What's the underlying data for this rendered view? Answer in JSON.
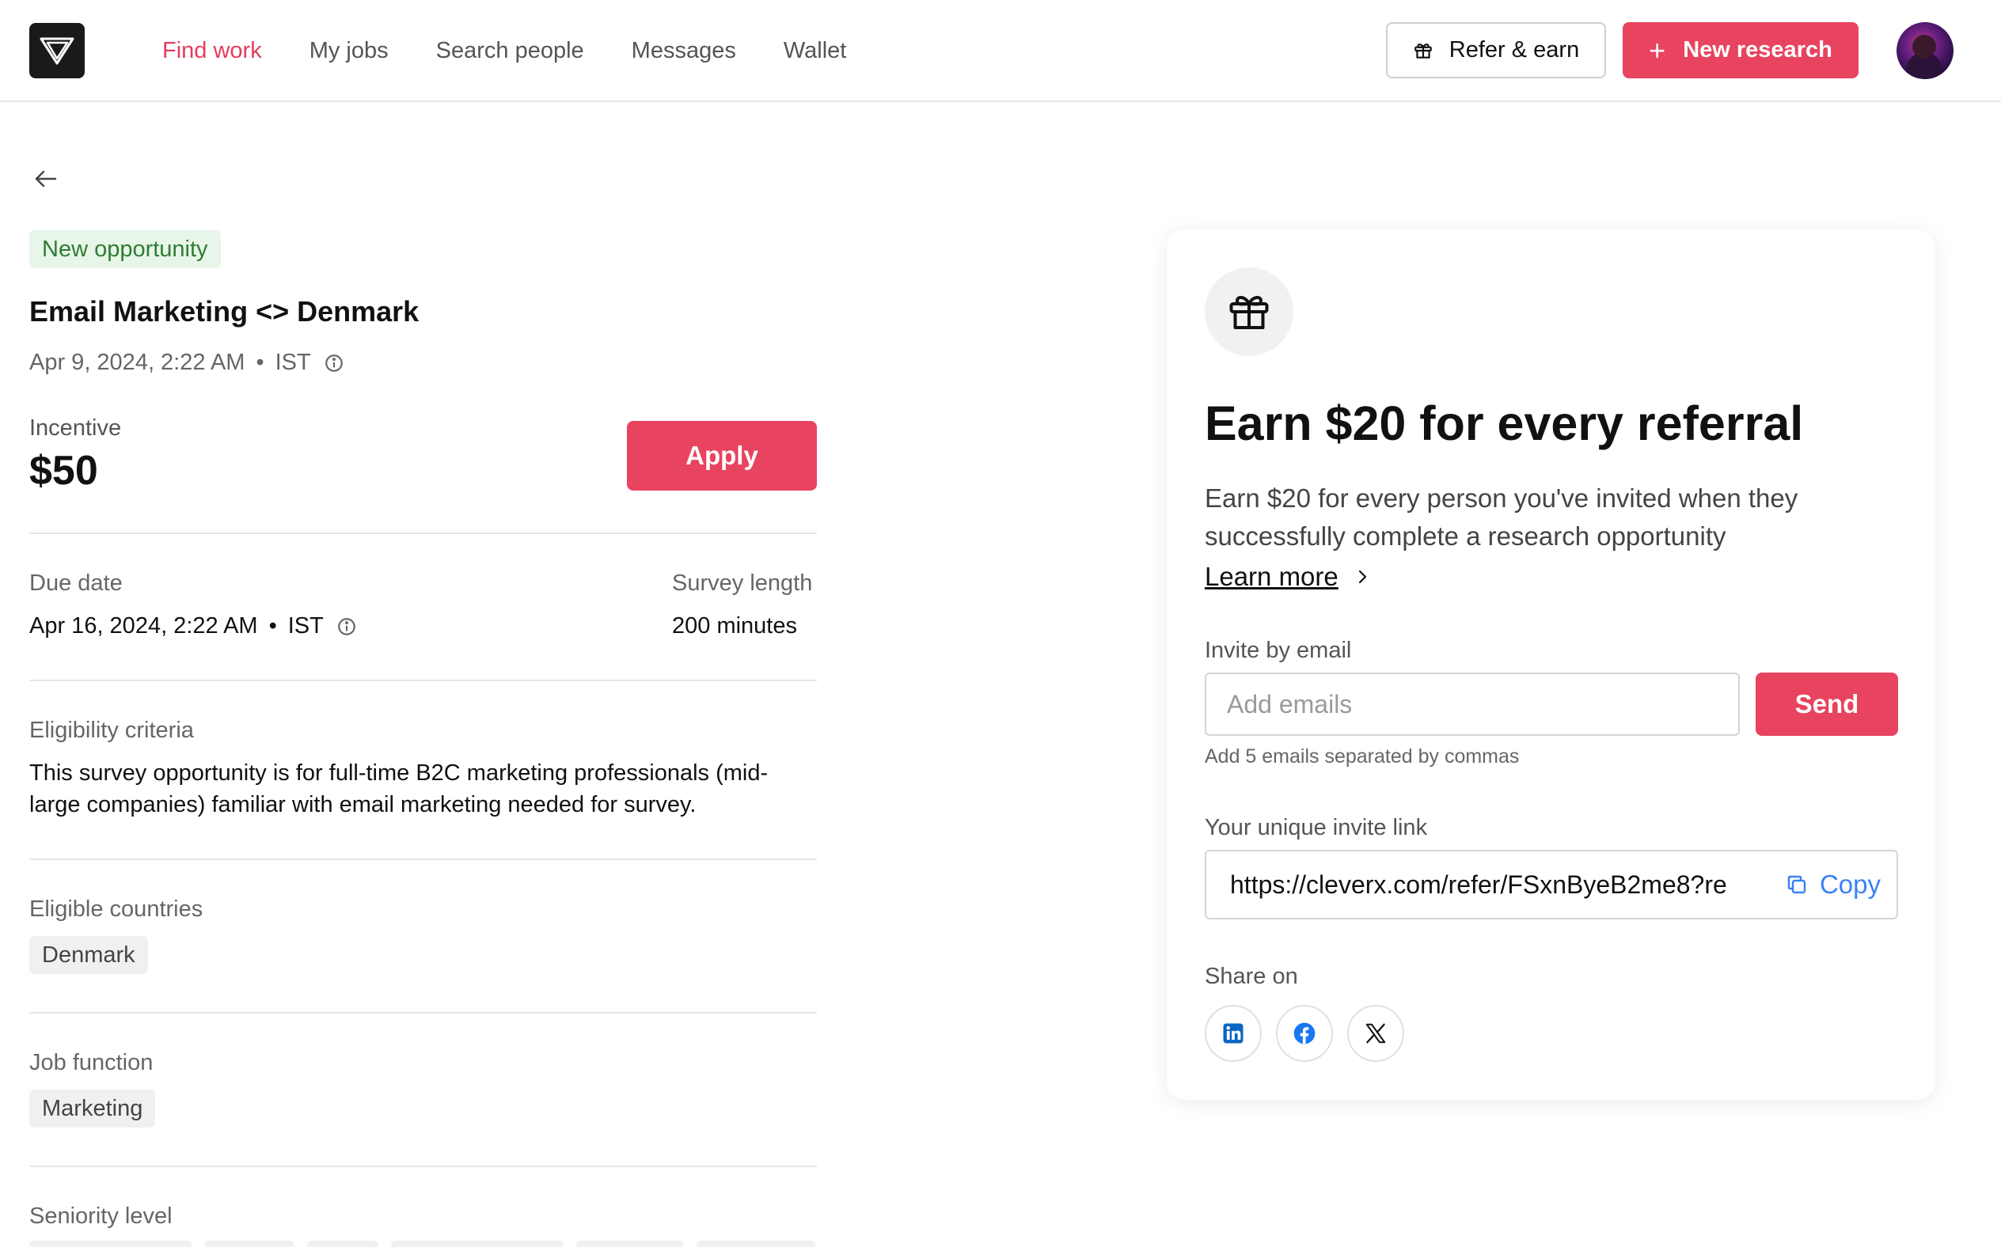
{
  "header": {
    "nav": [
      "Find work",
      "My jobs",
      "Search people",
      "Messages",
      "Wallet"
    ],
    "active_nav": "Find work",
    "refer_label": "Refer & earn",
    "new_research_label": "New research"
  },
  "job": {
    "badge": "New opportunity",
    "title": "Email Marketing <> Denmark",
    "posted_date": "Apr 9, 2024, 2:22 AM",
    "posted_tz": "IST",
    "incentive_label": "Incentive",
    "incentive_value": "$50",
    "apply_label": "Apply",
    "due_label": "Due date",
    "due_date": "Apr 16, 2024, 2:22 AM",
    "due_tz": "IST",
    "length_label": "Survey length",
    "length_value": "200 minutes",
    "criteria_label": "Eligibility criteria",
    "criteria_text": "This survey opportunity is for full-time B2C marketing professionals (mid-large companies) familiar with email marketing needed for survey.",
    "countries_label": "Eligible countries",
    "countries": [
      "Denmark"
    ],
    "function_label": "Job function",
    "functions": [
      "Marketing"
    ],
    "seniority_label": "Seniority level"
  },
  "referral": {
    "title": "Earn $20 for every referral",
    "description": "Earn $20 for every person you've invited when they successfully complete a research opportunity",
    "learn_more": "Learn more",
    "invite_email_label": "Invite by email",
    "email_placeholder": "Add emails",
    "send_label": "Send",
    "email_hint": "Add 5 emails separated by commas",
    "invite_link_label": "Your unique invite link",
    "invite_link": "https://cleverx.com/refer/FSxnByeB2me8?re",
    "copy_label": "Copy",
    "share_label": "Share on",
    "share_icons": [
      "linkedin-icon",
      "facebook-icon",
      "x-icon"
    ],
    "colors": {
      "accent": "#e8435f",
      "link": "#3b82f6",
      "linkedin": "#0a66c2",
      "facebook": "#1877f2"
    }
  }
}
